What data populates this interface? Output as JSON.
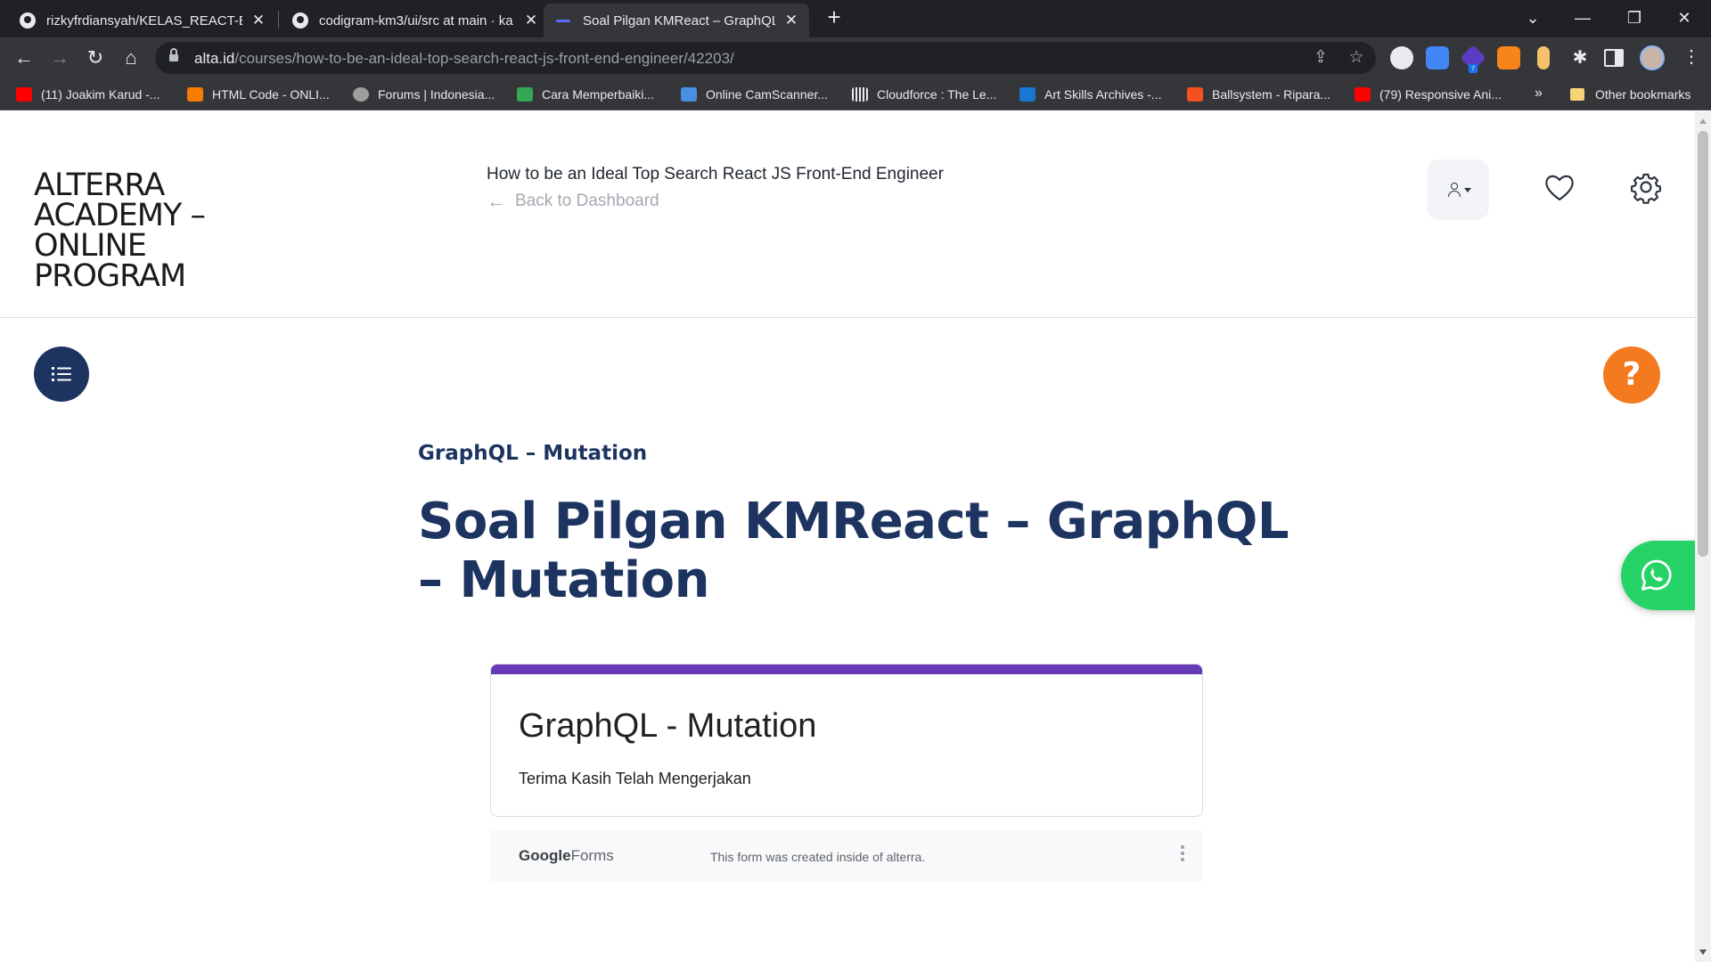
{
  "browser": {
    "tabs": [
      {
        "title": "rizkyfrdiansyah/KELAS_REACT-B",
        "close": "✕",
        "active": false
      },
      {
        "title": "codigram-km3/ui/src at main · ka",
        "close": "✕",
        "active": false
      },
      {
        "title": "Soal Pilgan KMReact – GraphQL",
        "close": "✕",
        "active": true
      }
    ],
    "new_tab": "+",
    "window_controls": {
      "minimize": "—",
      "restore": "❐",
      "close": "✕",
      "list": "⌄"
    },
    "nav": {
      "back": "←",
      "forward": "→",
      "reload": "↻",
      "home": "⌂"
    },
    "url": {
      "host": "alta.id",
      "path": "/courses/how-to-be-an-ideal-top-search-react-js-front-end-engineer/42203/"
    },
    "omnibox_icons": {
      "share": "⇪",
      "star": "☆"
    },
    "extension_badge": "7",
    "menu": "⋮",
    "bookmarks": [
      {
        "label": "(11) Joakim Karud -...",
        "color": "#ff0000"
      },
      {
        "label": "HTML Code - ONLI...",
        "color": "#f57c00"
      },
      {
        "label": "Forums | Indonesia...",
        "color": "#9e9e9e"
      },
      {
        "label": "Cara Memperbaiki...",
        "color": "#34a853"
      },
      {
        "label": "Online CamScanner...",
        "color": "#4a90e2"
      },
      {
        "label": "Cloudforce : The Le...",
        "color": "#e8eaed"
      },
      {
        "label": "Art Skills Archives -...",
        "color": "#1976d2"
      },
      {
        "label": "Ballsystem - Ripara...",
        "color": "#f4511e"
      },
      {
        "label": "(79) Responsive Ani...",
        "color": "#ff0000"
      }
    ],
    "bookmarks_more": "»",
    "other_bookmarks": "Other bookmarks"
  },
  "site": {
    "logo_text": "ALTERRA ACADEMY – ONLINE PROGRAM",
    "course_title": "How to be an Ideal Top Search React JS Front-End Engineer",
    "back_label": "Back to Dashboard",
    "back_arrow": "←",
    "help_label": "?"
  },
  "lesson": {
    "section": "GraphQL – Mutation",
    "title": "Soal Pilgan KMReact – GraphQL – Mutation"
  },
  "form": {
    "title": "GraphQL - Mutation",
    "message": "Terima Kasih Telah Mengerjakan",
    "brand_google": "Google",
    "brand_forms": "Forms",
    "footer_note": "This form was created inside of alterra.",
    "accent_color": "#673ab7"
  },
  "colors": {
    "navy": "#1d3461",
    "orange": "#f47a20",
    "whatsapp": "#25d366"
  }
}
